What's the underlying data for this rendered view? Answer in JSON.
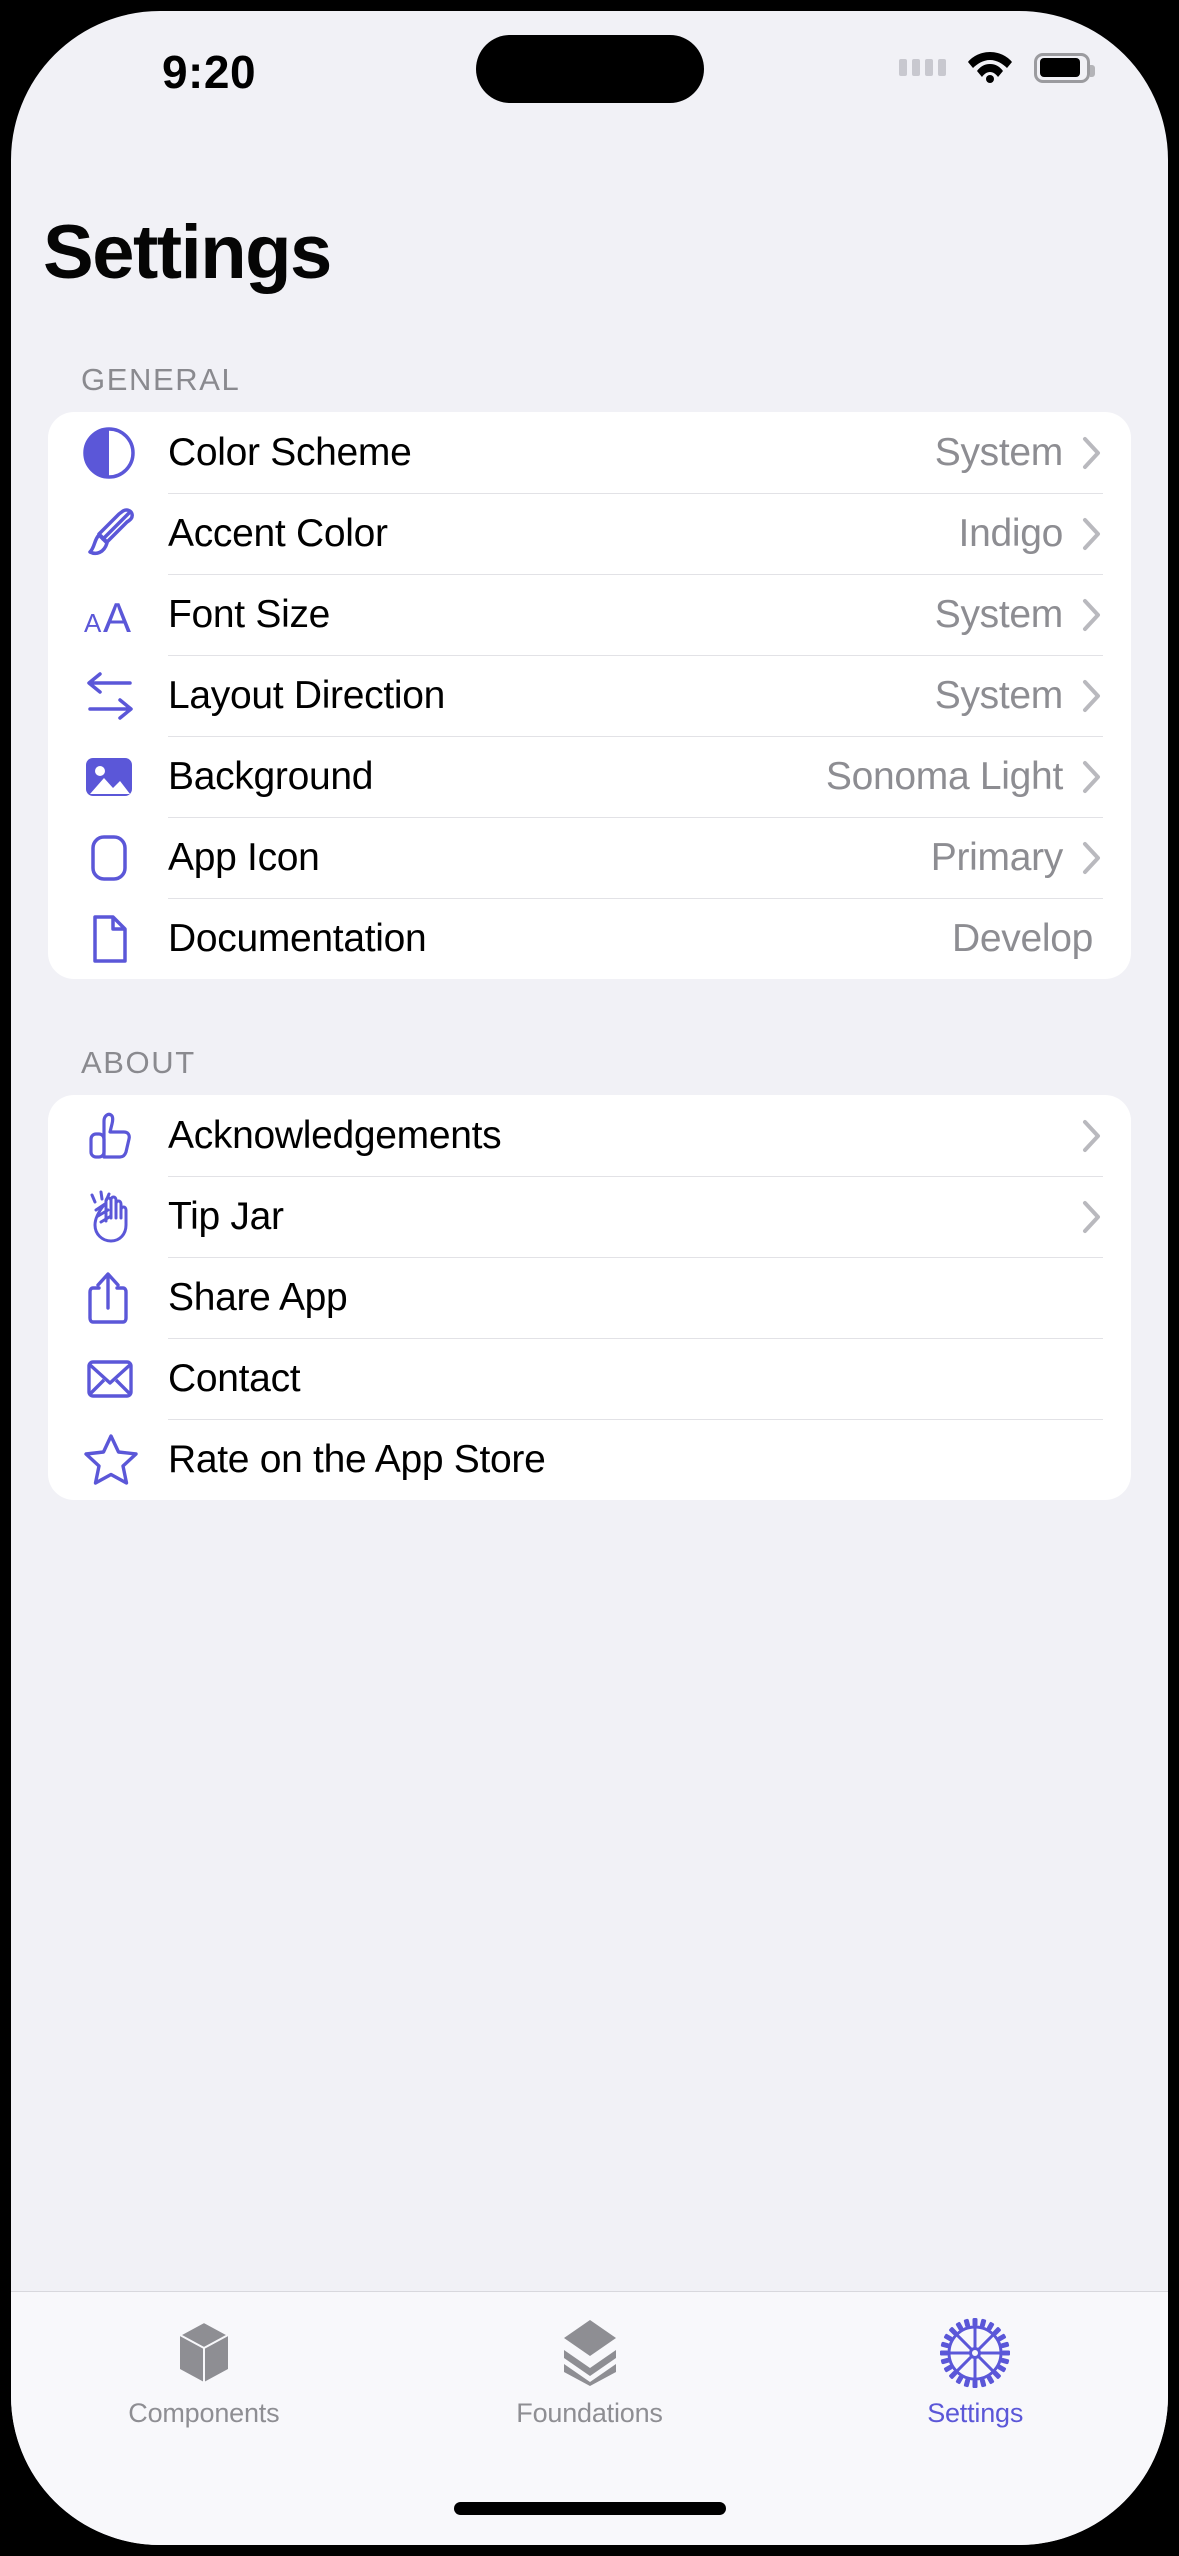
{
  "statusbar": {
    "time": "9:20",
    "cellular_icon": "cellular-dots-icon",
    "wifi_icon": "wifi-icon",
    "battery_icon": "battery-icon",
    "dynamic_island": "dynamic-island"
  },
  "header": {
    "title": "Settings"
  },
  "accent_color": "#5B57D8",
  "sections": [
    {
      "header": "GENERAL",
      "rows": [
        {
          "icon": "circle-lefthalf-filled-icon",
          "label": "Color Scheme",
          "value": "System",
          "chevron": true
        },
        {
          "icon": "paintbrush-icon",
          "label": "Accent Color",
          "value": "Indigo",
          "chevron": true
        },
        {
          "icon": "textformat-size-icon",
          "label": "Font Size",
          "value": "System",
          "chevron": true
        },
        {
          "icon": "arrow-left-arrow-right-icon",
          "label": "Layout Direction",
          "value": "System",
          "chevron": true
        },
        {
          "icon": "photo-icon",
          "label": "Background",
          "value": "Sonoma Light",
          "chevron": true
        },
        {
          "icon": "app-rounded-rect-icon",
          "label": "App Icon",
          "value": "Primary",
          "chevron": true
        },
        {
          "icon": "document-icon",
          "label": "Documentation",
          "value": "Develop",
          "chevron": false
        }
      ]
    },
    {
      "header": "ABOUT",
      "rows": [
        {
          "icon": "hand-thumbsup-icon",
          "label": "Acknowledgements",
          "value": "",
          "chevron": true
        },
        {
          "icon": "hands-clap-icon",
          "label": "Tip Jar",
          "value": "",
          "chevron": true
        },
        {
          "icon": "share-icon",
          "label": "Share App",
          "value": "",
          "chevron": false
        },
        {
          "icon": "envelope-icon",
          "label": "Contact",
          "value": "",
          "chevron": false
        },
        {
          "icon": "star-icon",
          "label": "Rate on the App Store",
          "value": "",
          "chevron": false
        }
      ]
    }
  ],
  "tabbar": {
    "tabs": [
      {
        "icon": "cube-icon",
        "label": "Components",
        "active": false
      },
      {
        "icon": "square-stack-icon",
        "label": "Foundations",
        "active": false
      },
      {
        "icon": "gear-icon",
        "label": "Settings",
        "active": true
      }
    ]
  }
}
